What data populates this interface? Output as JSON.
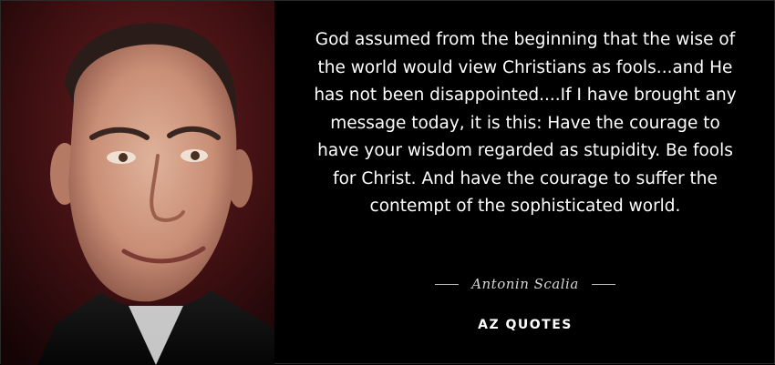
{
  "quote": {
    "text": "God assumed from the beginning that the wise of the world would view Christians as fools...and He has not been disappointed....If I have brought any message today, it is this: Have the courage to have your wisdom regarded as stupidity. Be fools for Christ. And have the courage to suffer the contempt of the sophisticated world."
  },
  "author": {
    "name": "Antonin Scalia"
  },
  "brand": {
    "logo_text": "AZ QUOTES"
  },
  "colors": {
    "background": "#000000",
    "quote_text": "#ffffff",
    "author_text": "#d6d6d6"
  }
}
